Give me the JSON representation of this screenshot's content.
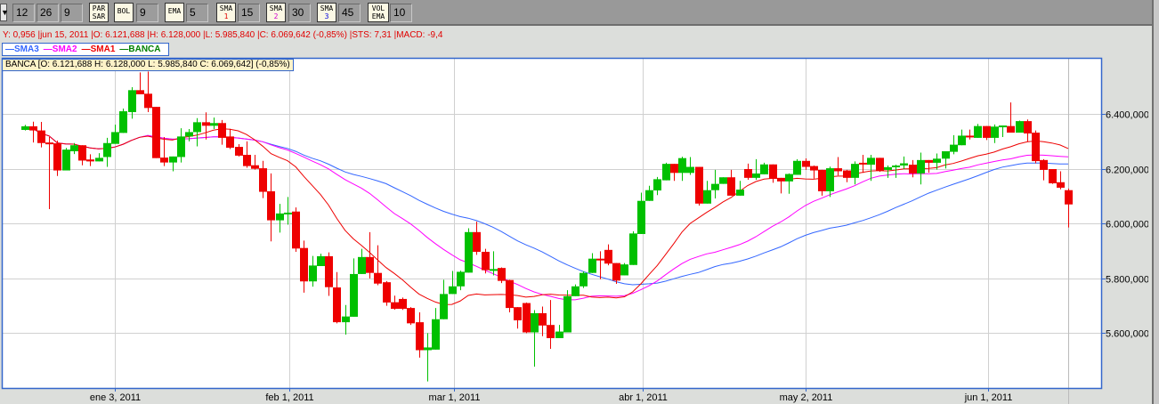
{
  "toolbar": {
    "macd_inputs": [
      "12",
      "26",
      "9"
    ],
    "parsar_label": [
      "PAR",
      "SAR"
    ],
    "bol_label": "BOL",
    "bol_value": "9",
    "ema_label": "EMA",
    "ema_value": "5",
    "sma1_label": "SMA",
    "sma1_num": "1",
    "sma1_value": "15",
    "sma2_label": "SMA",
    "sma2_num": "2",
    "sma2_value": "30",
    "sma3_label": "SMA",
    "sma3_num": "3",
    "sma3_value": "45",
    "volema_label": [
      "VOL",
      "EMA"
    ],
    "volema_value": "10"
  },
  "info_line": "Y: 0,956 |jun 15, 2011 |O: 6.121,688 |H: 6.128,000 |L: 5.985,840 |C: 6.069,642 (-0,85%) |STS: 7,31 |MACD: -9,4",
  "legend": [
    {
      "label": "—SMA3",
      "color": "#3366ff"
    },
    {
      "label": "—SMA2",
      "color": "#ff00ff"
    },
    {
      "label": "—SMA1",
      "color": "#ee0000"
    },
    {
      "label": "—BANCA",
      "color": "#008000"
    }
  ],
  "ohlc_box": "BANCA [O: 6.121,688  H: 6.128,000  L: 5.985,840  C: 6.069,642] (-0,85%)",
  "colors": {
    "up": "#00c000",
    "down": "#ee0000",
    "sma1": "#ee0000",
    "sma2": "#ff00ff",
    "sma3": "#3366ff",
    "border": "#3366cc",
    "grid": "#d0d0d0"
  },
  "chart_data": {
    "type": "candlestick",
    "title": "BANCA",
    "price_unit": "thousands",
    "ylim": [
      5400,
      6605
    ],
    "y_ticks": [
      {
        "value": 6400,
        "label": "6.400,000"
      },
      {
        "value": 6200,
        "label": "6.200,000"
      },
      {
        "value": 6000,
        "label": "6.000,000"
      },
      {
        "value": 5800,
        "label": "5.800,000"
      },
      {
        "value": 5600,
        "label": "5.600,000"
      }
    ],
    "x_ticks": [
      {
        "index": 11,
        "label": "ene 3, 2011"
      },
      {
        "index": 32.2,
        "label": "feb 1, 2011"
      },
      {
        "index": 52.3,
        "label": "mar 1, 2011"
      },
      {
        "index": 75.2,
        "label": "abr 1, 2011"
      },
      {
        "index": 95.1,
        "label": "may 2, 2011"
      },
      {
        "index": 117.2,
        "label": "jun 1, 2011"
      }
    ],
    "crosshair_index": 127,
    "sma_periods": {
      "sma1": 15,
      "sma2": 30,
      "sma3": 45
    },
    "ohlc": [
      [
        6342,
        6360,
        6340,
        6355
      ],
      [
        6355,
        6372,
        6296,
        6340
      ],
      [
        6340,
        6371,
        6278,
        6294
      ],
      [
        6296,
        6316,
        6053,
        6290
      ],
      [
        6293,
        6303,
        6174,
        6194
      ],
      [
        6194,
        6276,
        6194,
        6270
      ],
      [
        6264,
        6294,
        6254,
        6286
      ],
      [
        6286,
        6286,
        6213,
        6230
      ],
      [
        6234,
        6253,
        6210,
        6227
      ],
      [
        6227,
        6257,
        6227,
        6240
      ],
      [
        6243,
        6313,
        6207,
        6294
      ],
      [
        6291,
        6361,
        6291,
        6334
      ],
      [
        6331,
        6420,
        6331,
        6410
      ],
      [
        6407,
        6498,
        6383,
        6487
      ],
      [
        6487,
        6552,
        6472,
        6472
      ],
      [
        6474,
        6555,
        6407,
        6422
      ],
      [
        6426,
        6426,
        6239,
        6239
      ],
      [
        6241,
        6316,
        6210,
        6223
      ],
      [
        6223,
        6245,
        6191,
        6245
      ],
      [
        6243,
        6348,
        6223,
        6318
      ],
      [
        6318,
        6345,
        6300,
        6334
      ],
      [
        6334,
        6385,
        6282,
        6370
      ],
      [
        6370,
        6406,
        6307,
        6357
      ],
      [
        6357,
        6387,
        6345,
        6367
      ],
      [
        6367,
        6378,
        6288,
        6313
      ],
      [
        6318,
        6346,
        6272,
        6277
      ],
      [
        6280,
        6290,
        6245,
        6248
      ],
      [
        6251,
        6300,
        6204,
        6210
      ],
      [
        6213,
        6251,
        6197,
        6200
      ],
      [
        6202,
        6229,
        6093,
        6116
      ],
      [
        6118,
        6183,
        5935,
        6012
      ],
      [
        6012,
        6072,
        5967,
        6037
      ],
      [
        6037,
        6097,
        5996,
        6040
      ],
      [
        6044,
        6059,
        5897,
        5909
      ],
      [
        5911,
        5938,
        5748,
        5789
      ],
      [
        5789,
        5882,
        5770,
        5847
      ],
      [
        5845,
        5890,
        5845,
        5881
      ],
      [
        5881,
        5895,
        5736,
        5768
      ],
      [
        5767,
        5823,
        5636,
        5640
      ],
      [
        5640,
        5703,
        5595,
        5661
      ],
      [
        5660,
        5873,
        5660,
        5816
      ],
      [
        5816,
        5908,
        5816,
        5878
      ],
      [
        5878,
        5969,
        5800,
        5820
      ],
      [
        5820,
        5921,
        5775,
        5781
      ],
      [
        5786,
        5790,
        5700,
        5712
      ],
      [
        5713,
        5737,
        5686,
        5689
      ],
      [
        5725,
        5730,
        5685,
        5689
      ],
      [
        5692,
        5695,
        5630,
        5636
      ],
      [
        5640,
        5676,
        5511,
        5538
      ],
      [
        5538,
        5600,
        5424,
        5548
      ],
      [
        5540,
        5692,
        5540,
        5651
      ],
      [
        5651,
        5795,
        5651,
        5743
      ],
      [
        5743,
        5827,
        5743,
        5771
      ],
      [
        5771,
        5828,
        5757,
        5824
      ],
      [
        5821,
        5983,
        5821,
        5969
      ],
      [
        5969,
        6007,
        5886,
        5897
      ],
      [
        5897,
        5908,
        5818,
        5830
      ],
      [
        5830,
        5899,
        5811,
        5834
      ],
      [
        5838,
        5840,
        5783,
        5791
      ],
      [
        5794,
        5795,
        5676,
        5692
      ],
      [
        5695,
        5695,
        5617,
        5647
      ],
      [
        5710,
        5712,
        5600,
        5603
      ],
      [
        5603,
        5684,
        5478,
        5673
      ],
      [
        5673,
        5697,
        5589,
        5628
      ],
      [
        5630,
        5721,
        5543,
        5582
      ],
      [
        5582,
        5630,
        5582,
        5606
      ],
      [
        5603,
        5757,
        5603,
        5735
      ],
      [
        5735,
        5778,
        5735,
        5771
      ],
      [
        5771,
        5825,
        5765,
        5820
      ],
      [
        5820,
        5892,
        5820,
        5872
      ],
      [
        5872,
        5899,
        5797,
        5866
      ],
      [
        5904,
        5924,
        5848,
        5854
      ],
      [
        5856,
        5856,
        5780,
        5792
      ],
      [
        5811,
        5856,
        5811,
        5851
      ],
      [
        5849,
        5972,
        5849,
        5964
      ],
      [
        5962,
        6113,
        5962,
        6083
      ],
      [
        6083,
        6138,
        6083,
        6122
      ],
      [
        6121,
        6170,
        6104,
        6162
      ],
      [
        6158,
        6222,
        6158,
        6218
      ],
      [
        6218,
        6218,
        6156,
        6185
      ],
      [
        6185,
        6244,
        6156,
        6239
      ],
      [
        6185,
        6243,
        6178,
        6207
      ],
      [
        6207,
        6207,
        6066,
        6073
      ],
      [
        6073,
        6156,
        6073,
        6122
      ],
      [
        6122,
        6196,
        6092,
        6145
      ],
      [
        6145,
        6169,
        6145,
        6169
      ],
      [
        6169,
        6196,
        6102,
        6102
      ],
      [
        6102,
        6156,
        6102,
        6124
      ],
      [
        6199,
        6219,
        6160,
        6167
      ],
      [
        6167,
        6235,
        6160,
        6183
      ],
      [
        6180,
        6222,
        6180,
        6216
      ],
      [
        6216,
        6216,
        6149,
        6165
      ],
      [
        6167,
        6167,
        6110,
        6154
      ],
      [
        6154,
        6183,
        6109,
        6181
      ],
      [
        6178,
        6235,
        6178,
        6229
      ],
      [
        6229,
        6238,
        6196,
        6207
      ],
      [
        6210,
        6212,
        6164,
        6194
      ],
      [
        6196,
        6196,
        6102,
        6118
      ],
      [
        6118,
        6208,
        6097,
        6202
      ],
      [
        6202,
        6243,
        6176,
        6191
      ],
      [
        6194,
        6196,
        6151,
        6167
      ],
      [
        6167,
        6227,
        6143,
        6218
      ],
      [
        6222,
        6251,
        6185,
        6219
      ],
      [
        6215,
        6251,
        6156,
        6240
      ],
      [
        6240,
        6240,
        6189,
        6194
      ],
      [
        6196,
        6212,
        6167,
        6206
      ],
      [
        6206,
        6215,
        6167,
        6212
      ],
      [
        6212,
        6245,
        6200,
        6220
      ],
      [
        6215,
        6232,
        6169,
        6183
      ],
      [
        6183,
        6259,
        6143,
        6232
      ],
      [
        6232,
        6232,
        6186,
        6222
      ],
      [
        6222,
        6256,
        6197,
        6237
      ],
      [
        6237,
        6264,
        6201,
        6264
      ],
      [
        6262,
        6323,
        6253,
        6288
      ],
      [
        6286,
        6343,
        6286,
        6321
      ],
      [
        6321,
        6343,
        6307,
        6315
      ],
      [
        6313,
        6364,
        6313,
        6356
      ],
      [
        6356,
        6356,
        6305,
        6313
      ],
      [
        6313,
        6362,
        6294,
        6354
      ],
      [
        6354,
        6358,
        6316,
        6358
      ],
      [
        6356,
        6442,
        6332,
        6332
      ],
      [
        6332,
        6376,
        6332,
        6374
      ],
      [
        6374,
        6380,
        6299,
        6329
      ],
      [
        6332,
        6340,
        6220,
        6228
      ],
      [
        6232,
        6235,
        6158,
        6196
      ],
      [
        6199,
        6199,
        6145,
        6147
      ],
      [
        6151,
        6191,
        6125,
        6131
      ],
      [
        6122,
        6128,
        5986,
        6070
      ]
    ]
  }
}
